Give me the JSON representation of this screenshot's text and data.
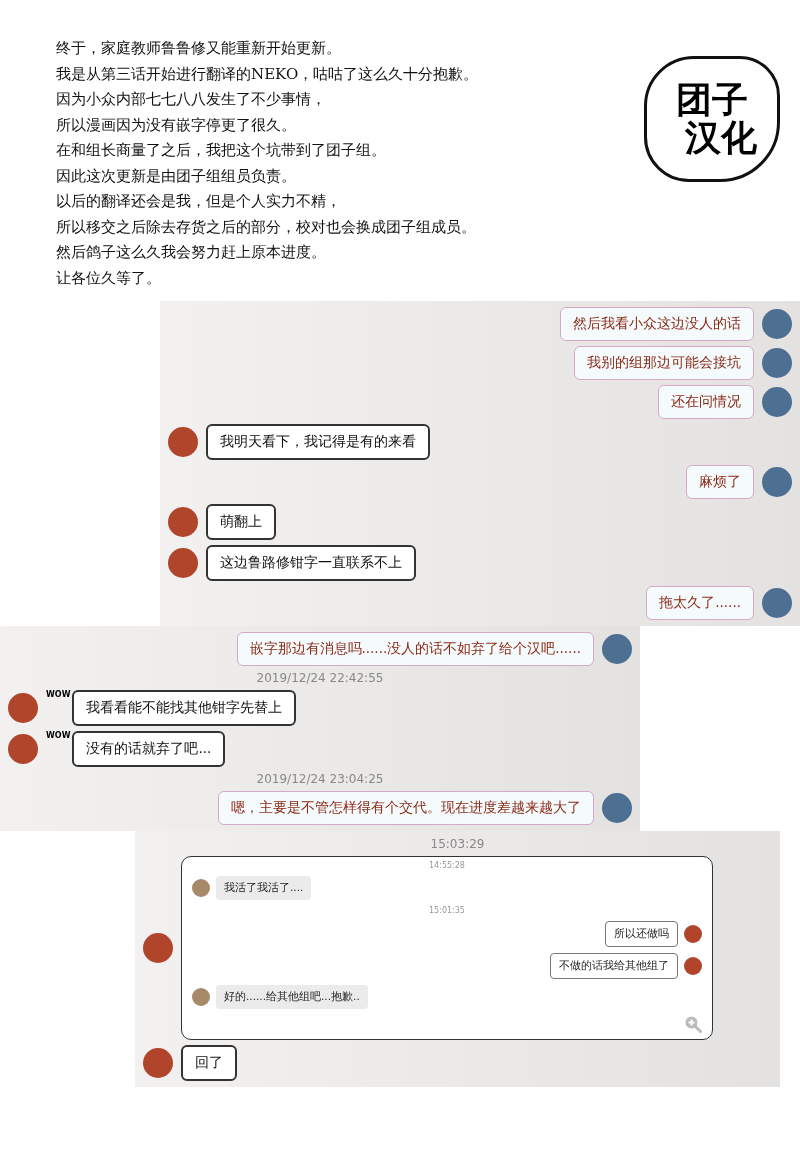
{
  "announcement": {
    "lines": [
      "终于，家庭教师鲁鲁修又能重新开始更新。",
      "我是从第三话开始进行翻译的NEKO，咕咕了这么久十分抱歉。",
      "因为小众内部七七八八发生了不少事情，",
      "所以漫画因为没有嵌字停更了很久。",
      "在和组长商量了之后，我把这个坑带到了团子组。",
      "因此这次更新是由团子组组员负责。",
      "以后的翻译还会是我，但是个人实力不精，",
      "所以移交之后除去存货之后的部分，校对也会换成团子组成员。",
      "然后鸽子这么久我会努力赶上原本进度。",
      "让各位久等了。"
    ]
  },
  "logo": {
    "top": "团子",
    "bottom": "汉化"
  },
  "chats": [
    {
      "kind": "right",
      "messages": [
        {
          "kind": "sent",
          "text": "然后我看小众这边没人的话"
        },
        {
          "kind": "sent",
          "text": "我别的组那边可能会接坑"
        },
        {
          "kind": "sent",
          "text": "还在问情况"
        },
        {
          "kind": "received",
          "text": "我明天看下，我记得是有的来看"
        },
        {
          "kind": "sent",
          "text": "麻烦了"
        },
        {
          "kind": "received",
          "text": "萌翻上"
        },
        {
          "kind": "received",
          "text": "这边鲁路修钳字一直联系不上"
        },
        {
          "kind": "sent",
          "text": "拖太久了......"
        }
      ]
    },
    {
      "kind": "left",
      "messages": [
        {
          "kind": "sent",
          "text": "嵌字那边有消息吗......没人的话不如弃了给个汉吧......"
        },
        {
          "kind": "time",
          "text": "2019/12/24 22:42:55"
        },
        {
          "kind": "received",
          "text": "我看看能不能找其他钳字先替上",
          "badge": "WOW"
        },
        {
          "kind": "received",
          "text": "没有的话就弃了吧...",
          "badge": "WOW"
        },
        {
          "kind": "time",
          "text": "2019/12/24 23:04:25"
        },
        {
          "kind": "sent",
          "text": "嗯，主要是不管怎样得有个交代。现在进度差越来越大了"
        }
      ]
    },
    {
      "kind": "middle",
      "messages": [
        {
          "kind": "time",
          "text": "15:03:29"
        },
        {
          "kind": "forward",
          "items": [
            {
              "kind": "time",
              "text": "14:55:28"
            },
            {
              "kind": "received",
              "text": "我活了我活了...."
            },
            {
              "kind": "time",
              "text": "15:01:35"
            },
            {
              "kind": "sent",
              "text": "所以还做吗"
            },
            {
              "kind": "sent",
              "text": "不做的话我给其他组了"
            },
            {
              "kind": "received",
              "text": "好的......给其他组吧...抱歉.."
            }
          ]
        },
        {
          "kind": "received",
          "text": "回了"
        }
      ]
    }
  ]
}
